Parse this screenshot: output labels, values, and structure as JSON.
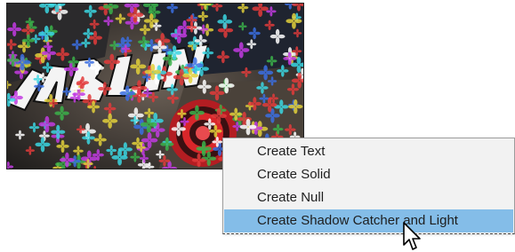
{
  "context_menu": {
    "items": [
      {
        "label": "Create Text"
      },
      {
        "label": "Create Solid"
      },
      {
        "label": "Create Null"
      },
      {
        "label": "Create Shadow Catcher and Light",
        "highlighted": true
      }
    ],
    "highlight_color": "#84bde8"
  },
  "composition_viewer": {
    "content": "tracked 3D camera solve points over graffiti footage",
    "track_point_colors": [
      "#e23b3b",
      "#3bb24a",
      "#3b6fe2",
      "#e2d03b",
      "#c23be2",
      "#3bd6e2",
      "#ffffff"
    ],
    "target_color": "#d8262a"
  },
  "cursor": {
    "icon": "arrow-pointer-icon"
  }
}
